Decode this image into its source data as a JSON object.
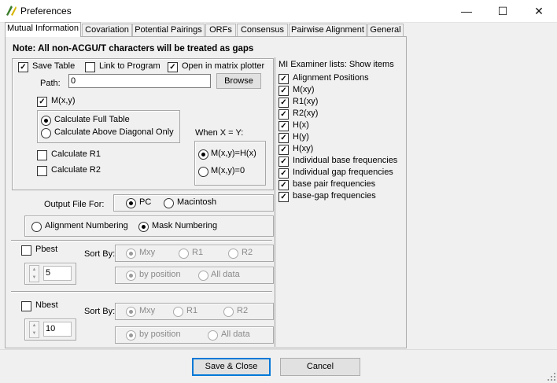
{
  "window": {
    "title": "Preferences",
    "minimize": "—",
    "maximize": "☐",
    "close": "✕"
  },
  "tabs": [
    "Mutual Information",
    "Covariation",
    "Potential Pairings",
    "ORFs",
    "Consensus",
    "Pairwise Alignment",
    "General"
  ],
  "note": "Note:  All non-ACGU/T characters will be treated as gaps",
  "save_table": {
    "label": "Save Table",
    "checked": true
  },
  "link_program": {
    "label": "Link to Program",
    "checked": false
  },
  "open_matrix": {
    "label": "Open in matrix plotter",
    "checked": true
  },
  "path": {
    "label": "Path:",
    "value": "0",
    "browse": "Browse"
  },
  "mxy": {
    "label": "M(x,y)",
    "checked": true
  },
  "calc_full": "Calculate Full Table",
  "calc_above": "Calculate Above Diagonal Only",
  "when_xy": "When X = Y:",
  "opt_mxy_hx": "M(x,y)=H(x)",
  "opt_mxy_0": "M(x,y)=0",
  "calc_r1": "Calculate R1",
  "calc_r2": "Calculate R2",
  "output_for": "Output File For:",
  "pc": "PC",
  "mac": "Macintosh",
  "align_num": "Alignment Numbering",
  "mask_num": "Mask Numbering",
  "pbest": {
    "label": "Pbest",
    "value": "5"
  },
  "nbest": {
    "label": "Nbest",
    "value": "10"
  },
  "sort_by": "Sort By:",
  "sort_p": [
    "Mxy",
    "R1",
    "R2"
  ],
  "sort_n": [
    "Mxy",
    "R1",
    "R2"
  ],
  "by_position": "by position",
  "all_data": "All data",
  "mi_header": "MI Examiner lists:  Show items",
  "mi_items": [
    "Alignment Positions",
    "M(xy)",
    "R1(xy)",
    "R2(xy)",
    "H(x)",
    "H(y)",
    "H(xy)",
    "Individual base frequencies",
    "Individual gap frequencies",
    "base pair frequencies",
    "base-gap frequencies"
  ],
  "buttons": {
    "save_close": "Save & Close",
    "cancel": "Cancel"
  },
  "check_mark": "✓"
}
